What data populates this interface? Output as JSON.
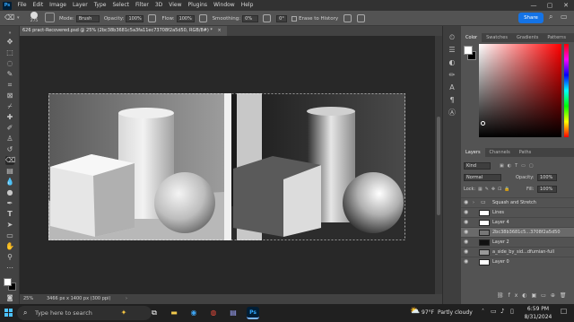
{
  "menubar": {
    "app_logo": "Ps",
    "items": [
      "File",
      "Edit",
      "Image",
      "Layer",
      "Type",
      "Select",
      "Filter",
      "3D",
      "View",
      "Plugins",
      "Window",
      "Help"
    ],
    "window_controls": [
      "—",
      "▢",
      "✕"
    ]
  },
  "options": {
    "brush_size": "275",
    "mode_label": "Mode:",
    "mode_value": "Brush",
    "opacity_label": "Opacity:",
    "opacity_value": "100%",
    "flow_label": "Flow:",
    "flow_value": "100%",
    "smoothing_label": "Smoothing:",
    "smoothing_value": "0%",
    "angle_value": "0°",
    "erase_history_label": "Erase to History",
    "share_label": "Share"
  },
  "document": {
    "tab_title": "626 pract-Recovered.psd @ 25% (2bc38b3681c5a3fa11ec73708f2a5d50, RGB/8#) *",
    "tab_close": "×"
  },
  "status": {
    "zoom": "25%",
    "doc_size": "3466 px x 1400 px (300 ppi)",
    "arrow": "›"
  },
  "color_panel": {
    "tabs": [
      "Color",
      "Swatches",
      "Gradients",
      "Patterns"
    ],
    "foreground": "#ffffff",
    "background": "#000000"
  },
  "layers_panel": {
    "tabs": [
      "Layers",
      "Channels",
      "Paths"
    ],
    "kind_label": "Kind",
    "blend_mode": "Normal",
    "opacity_label": "Opacity:",
    "opacity_value": "100%",
    "lock_label": "Lock:",
    "fill_label": "Fill:",
    "fill_value": "100%",
    "layers": [
      {
        "name": "Squash and Stretch",
        "group": true,
        "selected": false
      },
      {
        "name": "Lines",
        "group": false,
        "selected": false
      },
      {
        "name": "Layer 4",
        "group": false,
        "selected": false
      },
      {
        "name": "2bc38b3681c5...3708f2a5d50",
        "group": false,
        "selected": true
      },
      {
        "name": "Layer 2",
        "group": false,
        "selected": false
      },
      {
        "name": "a_side_by_sid...dfumian-full",
        "group": false,
        "selected": false
      },
      {
        "name": "Layer 0",
        "group": false,
        "selected": false
      }
    ]
  },
  "taskbar": {
    "search_placeholder": "Type here to search",
    "weather_temp": "97°F",
    "weather_desc": "Partly cloudy",
    "time": "6:59 PM",
    "date": "8/31/2024"
  }
}
